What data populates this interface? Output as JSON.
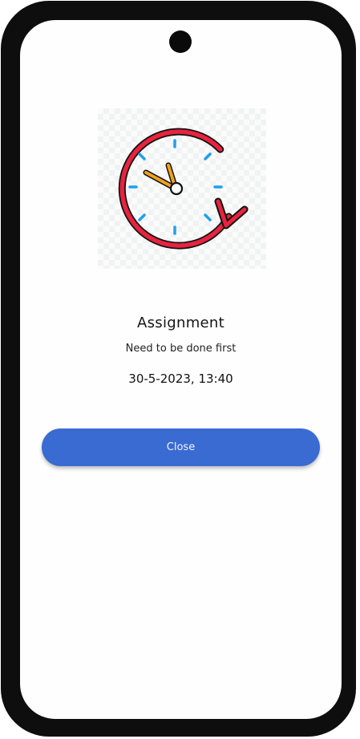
{
  "dialog": {
    "title": "Assignment",
    "description": "Need to be done first",
    "due_datetime": "30-5-2023, 13:40",
    "close_label": "Close"
  },
  "illustration": {
    "icon": "clock-with-circular-arrow-icon",
    "colors": {
      "arrow": "#e8233f",
      "hands": "#f0a21a",
      "ticks": "#1ea0f0"
    }
  },
  "theme": {
    "button_color": "#3a6bd3",
    "frame_color": "#0e0e0e"
  }
}
